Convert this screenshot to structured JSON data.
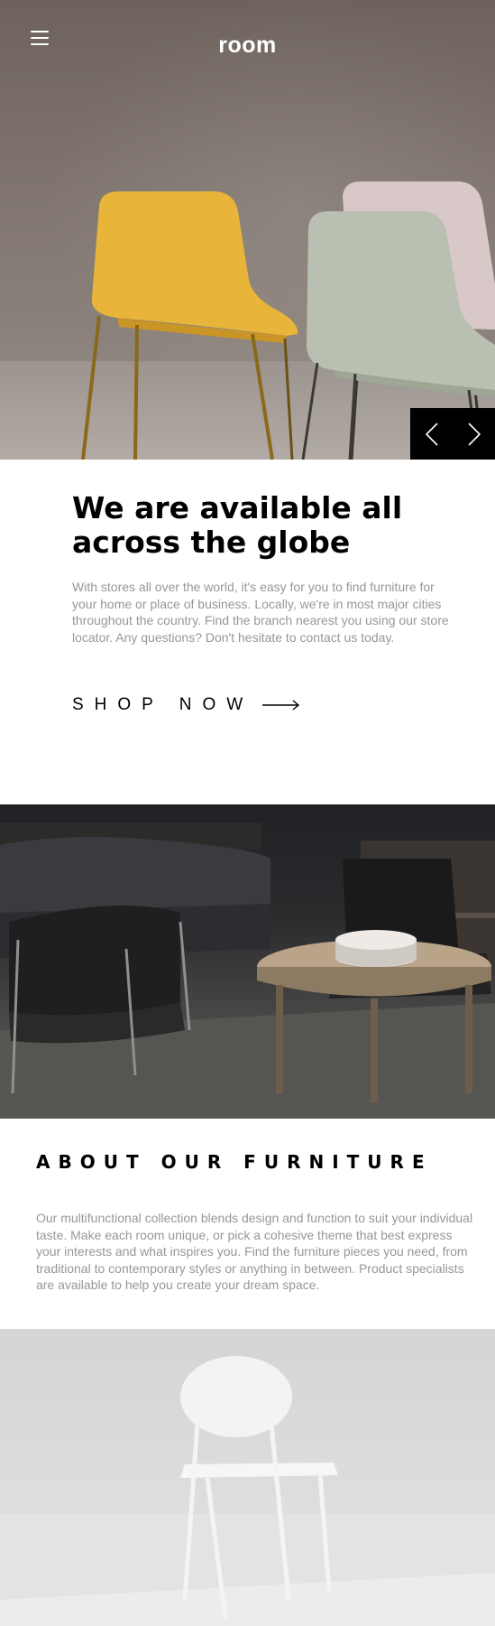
{
  "header": {
    "logo": "room",
    "menu_icon": "hamburger-menu-icon"
  },
  "hero": {
    "image": "chairs-photo",
    "prev_icon": "chevron-left-icon",
    "next_icon": "chevron-right-icon"
  },
  "intro": {
    "title_line1": "We are available all",
    "title_line2": "across the globe",
    "body": "With stores all over the world, it's easy for you to find furniture for your home or place of business. Locally, we're in most major cities throughout the country. Find the branch nearest you using our store locator. Any questions? Don't hesitate to contact us today.",
    "cta_label": "SHOP NOW",
    "cta_icon": "arrow-right-icon"
  },
  "about": {
    "title": "ABOUT OUR FURNITURE",
    "body": "Our multifunctional collection blends design and function to suit your individual taste. Make each room unique, or pick a cohesive theme that best express your interests and what inspires you. Find the furniture pieces you need, from traditional to contemporary styles or anything in between. Product specialists are available to help you create your dream space."
  },
  "colors": {
    "accent": "#000000",
    "text_muted": "#979797",
    "background": "#ffffff"
  }
}
